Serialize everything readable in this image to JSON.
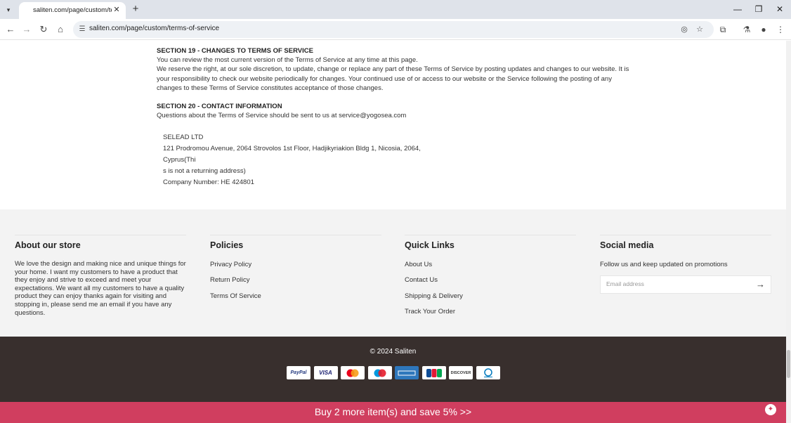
{
  "browser": {
    "tab_title": "saliten.com/page/custom/terms",
    "url": "saliten.com/page/custom/terms-of-service",
    "icons": {
      "tab_menu": "chevron-down-icon",
      "tab_close": "close-icon",
      "new_tab": "plus-icon",
      "minimize": "minimize-icon",
      "maximize": "restore-icon",
      "close": "close-icon",
      "back": "back-arrow-icon",
      "forward": "forward-arrow-icon",
      "reload": "reload-icon",
      "home": "home-icon",
      "site_info": "tune-icon",
      "eye_off": "eye-off-icon",
      "bookmark": "star-icon",
      "extensions": "puzzle-icon",
      "labs": "flask-icon",
      "profile": "profile-icon",
      "menu": "kebab-menu-icon"
    }
  },
  "terms": {
    "section19_title": "SECTION 19 - CHANGES TO TERMS OF SERVICE",
    "section19_p1": "You can review the most current version of the Terms of Service at any time at this page.",
    "section19_p2": "We reserve the right, at our sole discretion, to update, change or replace any part of these Terms of Service by posting updates and changes to our website. It is your responsibility to check our website periodically for changes. Your continued use of or access to our website or the Service following the posting of any changes to these Terms of Service constitutes acceptance of those changes.",
    "section20_title": "SECTION 20 - CONTACT INFORMATION",
    "section20_p1": "Questions about the Terms of Service should be sent to us at service@yogosea.com"
  },
  "company": {
    "name": "SELEAD LTD",
    "address_line1": "121 Prodromou Avenue, 2064 Strovolos 1st Floor, Hadjikyriakion Bldg 1, Nicosia, 2064, Cyprus(Thi",
    "address_line2": "s is not a returning address)",
    "company_number": "Company Number:  HE 424801"
  },
  "footer": {
    "about": {
      "title": "About our store",
      "text": "We love the design and making nice and unique things for your home. I want my customers to have a product that they enjoy and strive to exceed and meet your expectations. We want all my customers to have a quality product they can enjoy thanks again for visiting and stopping in, please send me an email if you have any questions."
    },
    "policies": {
      "title": "Policies",
      "links": [
        "Privacy Policy",
        "Return Policy",
        "Terms Of Service"
      ]
    },
    "quick_links": {
      "title": "Quick Links",
      "links": [
        "About Us",
        "Contact Us",
        "Shipping & Delivery",
        "Track Your Order"
      ]
    },
    "social": {
      "title": "Social media",
      "text": "Follow us and keep updated on promotions",
      "email_placeholder": "Email address",
      "submit_icon": "arrow-right-icon"
    }
  },
  "bottom": {
    "copyright": "© 2024 Saliten",
    "payments": [
      {
        "name": "PayPal",
        "icon": "paypal-icon",
        "color": "#253b80"
      },
      {
        "name": "VISA",
        "icon": "visa-icon",
        "color": "#1a1f71"
      },
      {
        "name": "",
        "icon": "mastercard-icon",
        "color": "#eb001b"
      },
      {
        "name": "",
        "icon": "maestro-icon",
        "color": "#0099df"
      },
      {
        "name": "",
        "icon": "amex-icon",
        "color": "#2e77bc"
      },
      {
        "name": "JCB",
        "icon": "jcb-icon",
        "color": "#0e4c96"
      },
      {
        "name": "DISCOVER",
        "icon": "discover-icon",
        "color": "#f48120"
      },
      {
        "name": "",
        "icon": "diners-club-icon",
        "color": "#0079be"
      }
    ]
  },
  "promo": {
    "text": "Buy 2 more item(s) and save 5%  >>",
    "color": "#d03e5f",
    "icon": "gift-icon"
  }
}
